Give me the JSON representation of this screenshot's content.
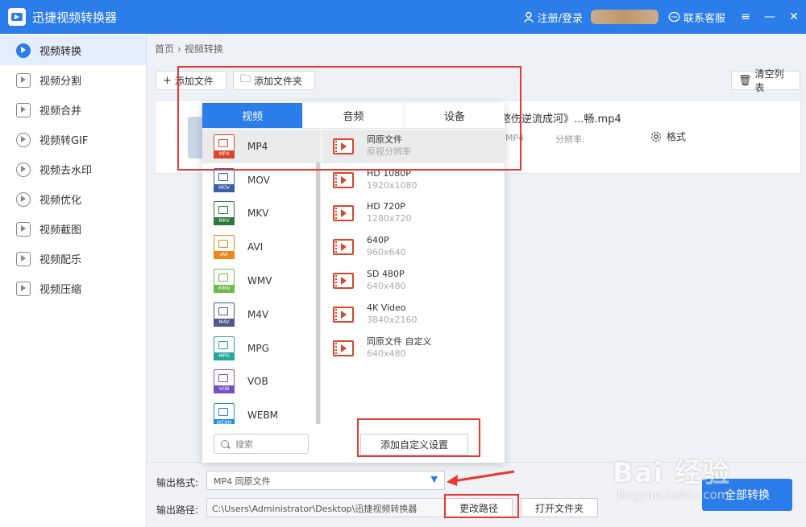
{
  "app": {
    "title": "迅捷视频转换器"
  },
  "header": {
    "login": "注册/登录",
    "service": "联系客服"
  },
  "window_controls": {
    "menu": "≡",
    "minimize": "—",
    "close": "✕"
  },
  "sidebar": {
    "items": [
      {
        "label": "视频转换",
        "icon": "convert-icon"
      },
      {
        "label": "视频分割",
        "icon": "split-icon"
      },
      {
        "label": "视频合并",
        "icon": "merge-icon"
      },
      {
        "label": "视频转GIF",
        "icon": "gif-icon"
      },
      {
        "label": "视频去水印",
        "icon": "watermark-icon"
      },
      {
        "label": "视频优化",
        "icon": "optimize-icon"
      },
      {
        "label": "视频截图",
        "icon": "screenshot-icon"
      },
      {
        "label": "视频配乐",
        "icon": "music-icon"
      },
      {
        "label": "视频压缩",
        "icon": "compress-icon"
      }
    ]
  },
  "breadcrumb": {
    "home": "首页",
    "sep": "›",
    "current": "视频转换"
  },
  "toolbar": {
    "add_file": "添加文件",
    "add_file_icon": "+",
    "add_folder": "添加文件夹",
    "add_folder_icon": "🗀",
    "clear": "清空列表",
    "clear_icon": "🗑"
  },
  "file": {
    "name": "愍伤逆流成河》...畅.mp4",
    "meta_fmt": "MP4",
    "meta_res": "分辨率:",
    "format_btn": "格式"
  },
  "popup": {
    "tabs": [
      "视频",
      "音频",
      "设备"
    ],
    "formats": [
      {
        "label": "MP4",
        "color": "#d9462b"
      },
      {
        "label": "MOV",
        "color": "#3a5fa8"
      },
      {
        "label": "MKV",
        "color": "#2f7a3a"
      },
      {
        "label": "AVI",
        "color": "#e98a1f"
      },
      {
        "label": "WMV",
        "color": "#6dbb4a"
      },
      {
        "label": "M4V",
        "color": "#4a5a8c"
      },
      {
        "label": "MPG",
        "color": "#26a69a"
      },
      {
        "label": "VOB",
        "color": "#7b4fc4"
      },
      {
        "label": "WEBM",
        "color": "#1e88e5"
      }
    ],
    "resolutions": [
      {
        "name": "同原文件",
        "dim": "原视分辨率"
      },
      {
        "name": "HD 1080P",
        "dim": "1920x1080"
      },
      {
        "name": "HD 720P",
        "dim": "1280x720"
      },
      {
        "name": "640P",
        "dim": "960x640"
      },
      {
        "name": "SD 480P",
        "dim": "640x480"
      },
      {
        "name": "4K Video",
        "dim": "3840x2160"
      },
      {
        "name": "同原文件 自定义",
        "dim": "640x480"
      }
    ],
    "search_placeholder": "搜索",
    "add_custom": "添加自定义设置"
  },
  "bottom": {
    "format_label": "输出格式:",
    "format_value": "MP4  同原文件",
    "path_label": "输出路径:",
    "path_value": "C:\\Users\\Administrator\\Desktop\\迅捷视频转换器",
    "change_path": "更改路径",
    "open_folder": "打开文件夹",
    "convert_all": "全部转换"
  },
  "watermark": {
    "big": "Bai 经验",
    "small": "jingyan.baidu.com"
  },
  "colors": {
    "accent": "#2b7de9",
    "annotation": "#e53935"
  }
}
